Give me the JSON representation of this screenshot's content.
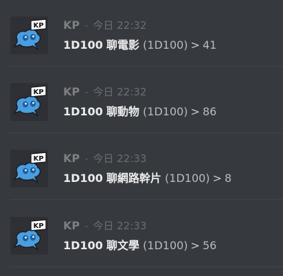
{
  "messages": [
    {
      "author": "KP",
      "separator": "-",
      "time": "今日 22:32",
      "code": "1D100",
      "topic": "聊電影",
      "paren": "(1D100)",
      "arrow": ">",
      "result": "41",
      "avatar_text": "KP"
    },
    {
      "author": "KP",
      "separator": "-",
      "time": "今日 22:32",
      "code": "1D100",
      "topic": "聊動物",
      "paren": "(1D100)",
      "arrow": ">",
      "result": "86",
      "avatar_text": "KP"
    },
    {
      "author": "KP",
      "separator": "-",
      "time": "今日 22:33",
      "code": "1D100",
      "topic": "聊網路幹片",
      "paren": "(1D100)",
      "arrow": ">",
      "result": "8",
      "avatar_text": "KP"
    },
    {
      "author": "KP",
      "separator": "-",
      "time": "今日 22:33",
      "code": "1D100",
      "topic": "聊文學",
      "paren": "(1D100)",
      "arrow": ">",
      "result": "56",
      "avatar_text": "KP"
    }
  ],
  "colors": {
    "background": "#36393e",
    "avatar_body": "#4a9ee0",
    "divider": "#41444a"
  }
}
